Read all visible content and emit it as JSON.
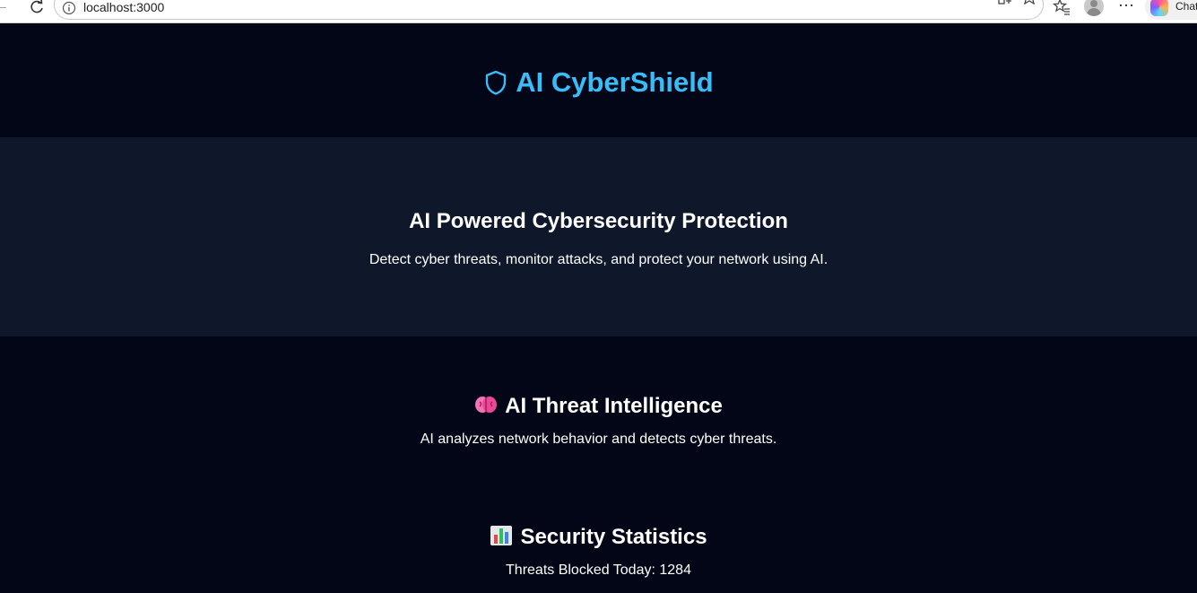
{
  "browser": {
    "url": "localhost:3000",
    "chat_label": "Chat"
  },
  "header": {
    "brand_icon": "shield-icon",
    "brand_name": "AI CyberShield",
    "accent_color": "#38bdf8"
  },
  "hero": {
    "title": "AI Powered Cybersecurity Protection",
    "subtitle": "Detect cyber threats, monitor attacks, and protect your network using AI."
  },
  "sections": {
    "intelligence": {
      "icon": "brain-icon",
      "title": "AI Threat Intelligence",
      "text": "AI analyzes network behavior and detects cyber threats."
    },
    "statistics": {
      "icon": "bar-chart-icon",
      "title": "Security Statistics",
      "text": "Threats Blocked Today: 1284"
    }
  },
  "colors": {
    "page_bg": "#020617",
    "hero_bg": "#0f172a",
    "text": "#ffffff"
  }
}
